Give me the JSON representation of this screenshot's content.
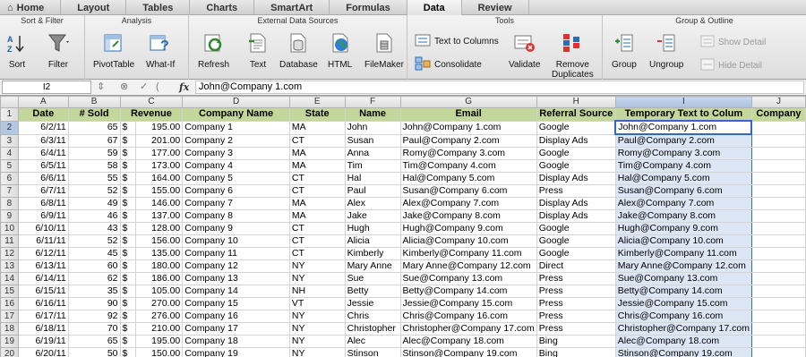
{
  "tabs": [
    {
      "label": "Home",
      "icon": "home-icon"
    },
    {
      "label": "Layout"
    },
    {
      "label": "Tables"
    },
    {
      "label": "Charts"
    },
    {
      "label": "SmartArt"
    },
    {
      "label": "Formulas"
    },
    {
      "label": "Data",
      "active": true
    },
    {
      "label": "Review"
    }
  ],
  "ribbon": {
    "groups": {
      "sort_filter": "Sort & Filter",
      "analysis": "Analysis",
      "external": "External Data Sources",
      "tools": "Tools",
      "group_outline": "Group & Outline"
    },
    "buttons": {
      "sort": "Sort",
      "filter": "Filter",
      "pivot": "PivotTable",
      "whatif": "What-If",
      "refresh": "Refresh",
      "text": "Text",
      "database": "Database",
      "html": "HTML",
      "filemaker": "FileMaker",
      "text_to_columns": "Text to Columns",
      "consolidate": "Consolidate",
      "validate": "Validate",
      "remove_duplicates_1": "Remove",
      "remove_duplicates_2": "Duplicates",
      "group": "Group",
      "ungroup": "Ungroup",
      "show_detail": "Show Detail",
      "hide_detail": "Hide Detail"
    }
  },
  "formula_bar": {
    "cell_ref": "I2",
    "fx": "fx",
    "content": "John@Company 1.com"
  },
  "columns": [
    "A",
    "B",
    "C",
    "D",
    "E",
    "F",
    "G",
    "H",
    "I",
    "J"
  ],
  "headers": [
    "Date",
    "# Sold",
    "Revenue",
    "Company Name",
    "State",
    "Name",
    "Email",
    "Referral Source",
    "Temporary Text to Colum",
    "Company"
  ],
  "rows": [
    [
      "6/2/11",
      "65",
      "$",
      "195.00",
      "Company 1",
      "MA",
      "John",
      "John@Company 1.com",
      "Google",
      "John@Company 1.com"
    ],
    [
      "6/3/11",
      "67",
      "$",
      "201.00",
      "Company 2",
      "CT",
      "Susan",
      "Paul@Company 2.com",
      "Display Ads",
      "Paul@Company 2.com"
    ],
    [
      "6/4/11",
      "59",
      "$",
      "177.00",
      "Company 3",
      "MA",
      "Anna",
      "Romy@Company 3.com",
      "Google",
      "Romy@Company 3.com"
    ],
    [
      "6/5/11",
      "58",
      "$",
      "173.00",
      "Company 4",
      "MA",
      "Tim",
      "Tim@Company 4.com",
      "Google",
      "Tim@Company 4.com"
    ],
    [
      "6/6/11",
      "55",
      "$",
      "164.00",
      "Company 5",
      "CT",
      "Hal",
      "Hal@Company 5.com",
      "Display Ads",
      "Hal@Company 5.com"
    ],
    [
      "6/7/11",
      "52",
      "$",
      "155.00",
      "Company 6",
      "CT",
      "Paul",
      "Susan@Company 6.com",
      "Press",
      "Susan@Company 6.com"
    ],
    [
      "6/8/11",
      "49",
      "$",
      "146.00",
      "Company 7",
      "MA",
      "Alex",
      "Alex@Company 7.com",
      "Display Ads",
      "Alex@Company 7.com"
    ],
    [
      "6/9/11",
      "46",
      "$",
      "137.00",
      "Company 8",
      "MA",
      "Jake",
      "Jake@Company 8.com",
      "Display Ads",
      "Jake@Company 8.com"
    ],
    [
      "6/10/11",
      "43",
      "$",
      "128.00",
      "Company 9",
      "CT",
      "Hugh",
      "Hugh@Company 9.com",
      "Google",
      "Hugh@Company 9.com"
    ],
    [
      "6/11/11",
      "52",
      "$",
      "156.00",
      "Company 10",
      "CT",
      "Alicia",
      "Alicia@Company 10.com",
      "Google",
      "Alicia@Company 10.com"
    ],
    [
      "6/12/11",
      "45",
      "$",
      "135.00",
      "Company 11",
      "CT",
      "Kimberly",
      "Kimberly@Company 11.com",
      "Google",
      "Kimberly@Company 11.com"
    ],
    [
      "6/13/11",
      "60",
      "$",
      "180.00",
      "Company 12",
      "NY",
      "Mary Anne",
      "Mary Anne@Company 12.com",
      "Direct",
      "Mary Anne@Company 12.com"
    ],
    [
      "6/14/11",
      "62",
      "$",
      "186.00",
      "Company 13",
      "NY",
      "Sue",
      "Sue@Company 13.com",
      "Press",
      "Sue@Company 13.com"
    ],
    [
      "6/15/11",
      "35",
      "$",
      "105.00",
      "Company 14",
      "NH",
      "Betty",
      "Betty@Company 14.com",
      "Press",
      "Betty@Company 14.com"
    ],
    [
      "6/16/11",
      "90",
      "$",
      "270.00",
      "Company 15",
      "VT",
      "Jessie",
      "Jessie@Company 15.com",
      "Press",
      "Jessie@Company 15.com"
    ],
    [
      "6/17/11",
      "92",
      "$",
      "276.00",
      "Company 16",
      "NY",
      "Chris",
      "Chris@Company 16.com",
      "Press",
      "Chris@Company 16.com"
    ],
    [
      "6/18/11",
      "70",
      "$",
      "210.00",
      "Company 17",
      "NY",
      "Christopher",
      "Christopher@Company 17.com",
      "Press",
      "Christopher@Company 17.com"
    ],
    [
      "6/19/11",
      "65",
      "$",
      "195.00",
      "Company 18",
      "NY",
      "Alec",
      "Alec@Company 18.com",
      "Bing",
      "Alec@Company 18.com"
    ],
    [
      "6/20/11",
      "50",
      "$",
      "150.00",
      "Company 19",
      "NY",
      "Stinson",
      "Stinson@Company 19.com",
      "Bing",
      "Stinson@Company 19.com"
    ]
  ]
}
